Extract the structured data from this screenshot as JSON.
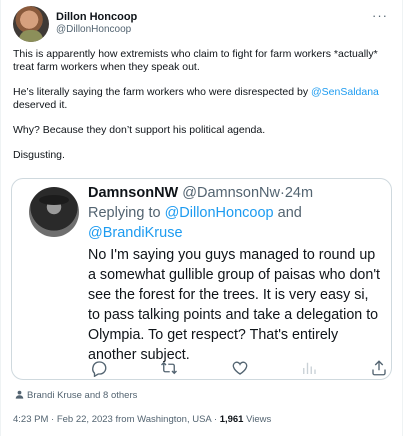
{
  "author": {
    "display_name": "Dillon Honcoop",
    "handle": "@DillonHoncoop",
    "avatar_icon": "profile-photo",
    "more_icon": "more-horizontal-icon"
  },
  "tweet": {
    "para1": "This is apparently how extremists who claim to fight for farm workers *actually* treat farm workers when they speak out.",
    "para2_before": "He’s literally saying the farm workers who were disrespected by ",
    "para2_mention": "@SenSaldana",
    "para2_after": " deserved it.",
    "para3": "Why? Because they don’t support his political agenda.",
    "para4": "Disgusting."
  },
  "quote": {
    "display_name": "DamnsonNW",
    "handle": "@DamnsonNw",
    "separator": "·",
    "time": "24m",
    "reply_prefix": "Replying to ",
    "reply_mention_1": "@DillonHoncoop",
    "reply_and": " and ",
    "reply_mention_2": "@BrandiKruse",
    "text": "No I'm saying you guys managed to round up a somewhat gullible group of paisas who don't see the forest for the trees. It is very easy si, to pass talking points and take a delegation to Olympia. To get respect? That's entirely another subject.",
    "actions": [
      "reply-icon",
      "retweet-icon",
      "like-icon",
      "analytics-icon",
      "share-icon"
    ]
  },
  "likers": {
    "text": "Brandi Kruse and 8 others",
    "icon": "person-icon"
  },
  "meta": {
    "time": "4:23 PM",
    "separator": "·",
    "date": "Feb 22, 2023",
    "location": "from Washington, USA",
    "views_count": "1,961",
    "views_label": "Views"
  },
  "colors": {
    "link": "#1d9bf0",
    "secondary": "#536471",
    "border": "#cfd9de",
    "text": "#0f1419"
  }
}
